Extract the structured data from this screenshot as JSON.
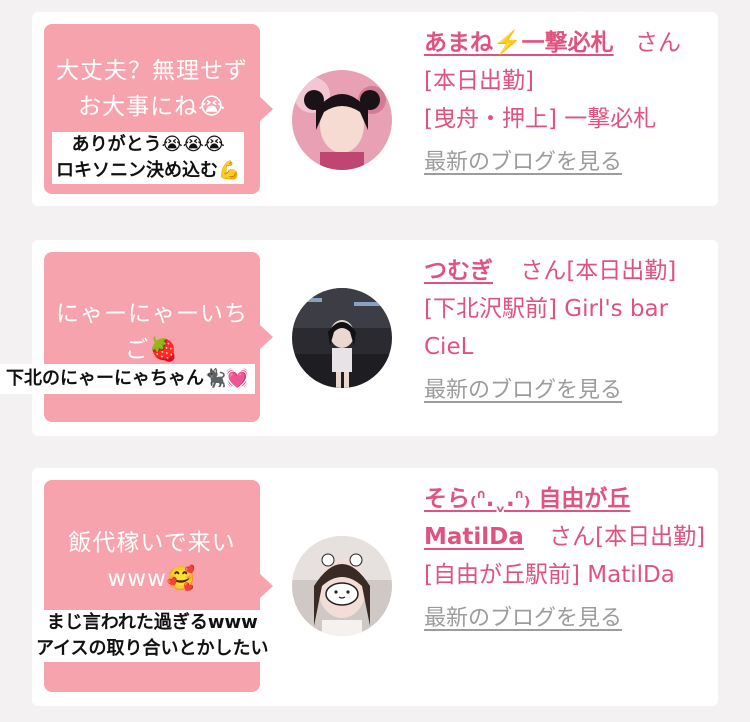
{
  "cards": [
    {
      "bubble_message": "大丈夫？無理せずお大事にね😭",
      "caption_lines": [
        "ありがとう😭😭😭",
        "ロキソニン決め込む💪"
      ],
      "cast_name": "あまね⚡️一撃必札",
      "suffix": "さん[本日出勤]",
      "shop": "[曳舟・押上] 一撃必札",
      "blog_link": "最新のブログを見る"
    },
    {
      "bubble_message": "にゃーにゃーいちご🍓",
      "caption_lines": [
        "下北のにゃーにゃちゃん🐈‍⬛💓"
      ],
      "cast_name": "つむぎ",
      "suffix": "さん[本日出勤]",
      "shop": "[下北沢駅前] Girl's bar CieL",
      "blog_link": "最新のブログを見る"
    },
    {
      "bubble_message": "飯代稼いで来いwww🥰",
      "caption_lines": [
        "まじ言われた過ぎるwww",
        "アイスの取り合いとかしたい"
      ],
      "cast_name": "そら₍ᐢ.ˬ.ᐢ₎ 自由が丘MatilDa",
      "suffix": "さん[本日出勤]",
      "shop": "[自由が丘駅前] MatilDa",
      "blog_link": "最新のブログを見る"
    }
  ]
}
